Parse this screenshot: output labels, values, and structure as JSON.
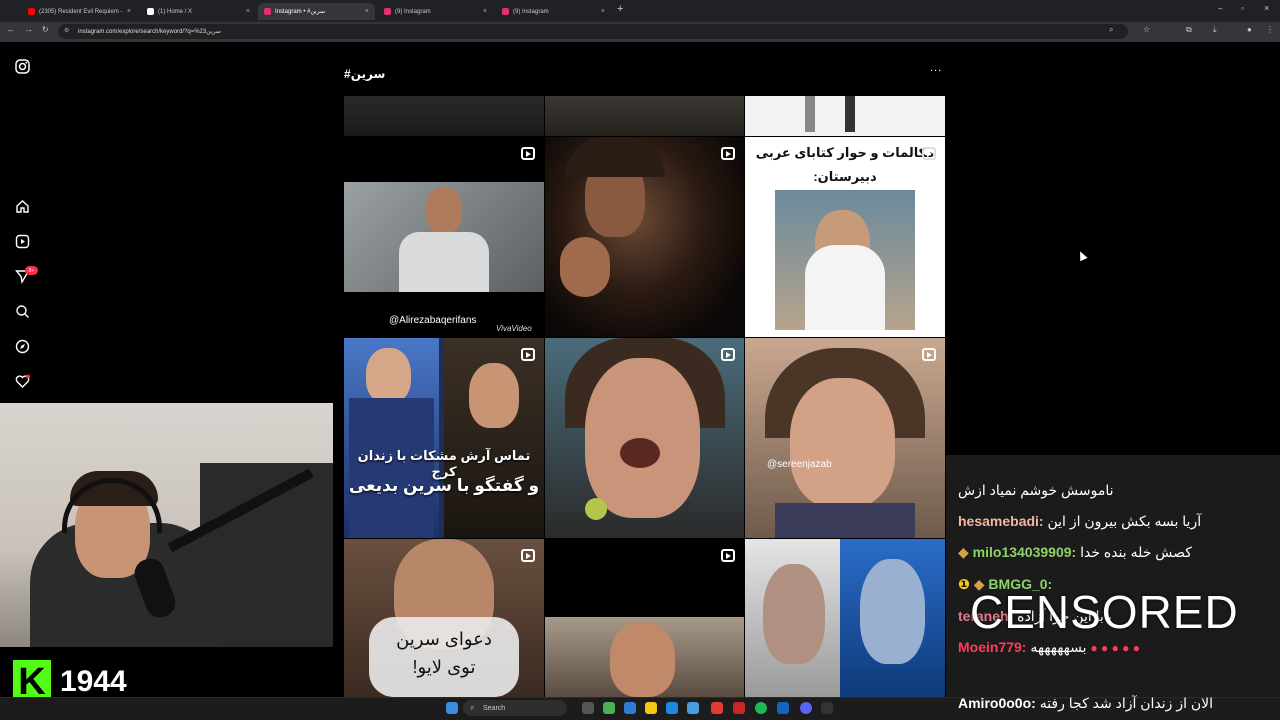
{
  "browser": {
    "tabs": [
      {
        "title": "(2305) Resident Evil Requiem -",
        "color": "#ff0000"
      },
      {
        "title": "(1) Home / X",
        "color": "#ffffff"
      },
      {
        "title": "Instagram • #سرین",
        "color": "#e1306c"
      },
      {
        "title": "(9) Instagram",
        "color": "#e1306c"
      },
      {
        "title": "(9) Instagram",
        "color": "#e1306c"
      }
    ],
    "new_tab": "+",
    "url": "instagram.com/explore/search/keyword/?q=%23سرین"
  },
  "instagram": {
    "hashtag_title": "#سرین",
    "more_label": "...",
    "nav_badge": "9+",
    "tiles": {
      "t1_title_l1": "مکالمات و حوار کتابای عربی",
      "t1_title_l2": "دبیرستان:",
      "t2_handle": "@Alirezabaqerifans",
      "t2_watermark": "VivaVideo",
      "t3_line1": "تماس آرش مشکات با زندان کرج",
      "t3_line2": "و گفتگو با سرین بدیعی",
      "t4_handle": "@sereenjazab",
      "t5_line1": "دعوای سرین",
      "t5_line2": "توی لایو!"
    }
  },
  "stream": {
    "kick_logo": "K",
    "viewer_count": "1944",
    "censored_label": "CENSORED",
    "chat": [
      {
        "user": "",
        "text": "ناموسش خوشم نمیاد ازش",
        "color": "#ffffff"
      },
      {
        "user": "hesamebadi:",
        "text": "آریا بسه بکش بیرون از این",
        "color": "#f5b7a0"
      },
      {
        "user": "milo134039909:",
        "text": "کصش خله بنده خدا",
        "color": "#8fd16a"
      },
      {
        "user": "BMGG_0:",
        "text": "",
        "color": "#8fd16a"
      },
      {
        "user": "teraneh:",
        "text": "بابا این چرا آزاده",
        "color": "#e07a8c"
      },
      {
        "user": "Moein779:",
        "text": "بسهههههه",
        "color": "#ff3b5c"
      },
      {
        "user": "Amiro0o0o:",
        "text": "الان از زندان آزاد شد کجا رفته",
        "color": "#ffffff"
      }
    ]
  },
  "taskbar": {
    "search_placeholder": "Search"
  }
}
